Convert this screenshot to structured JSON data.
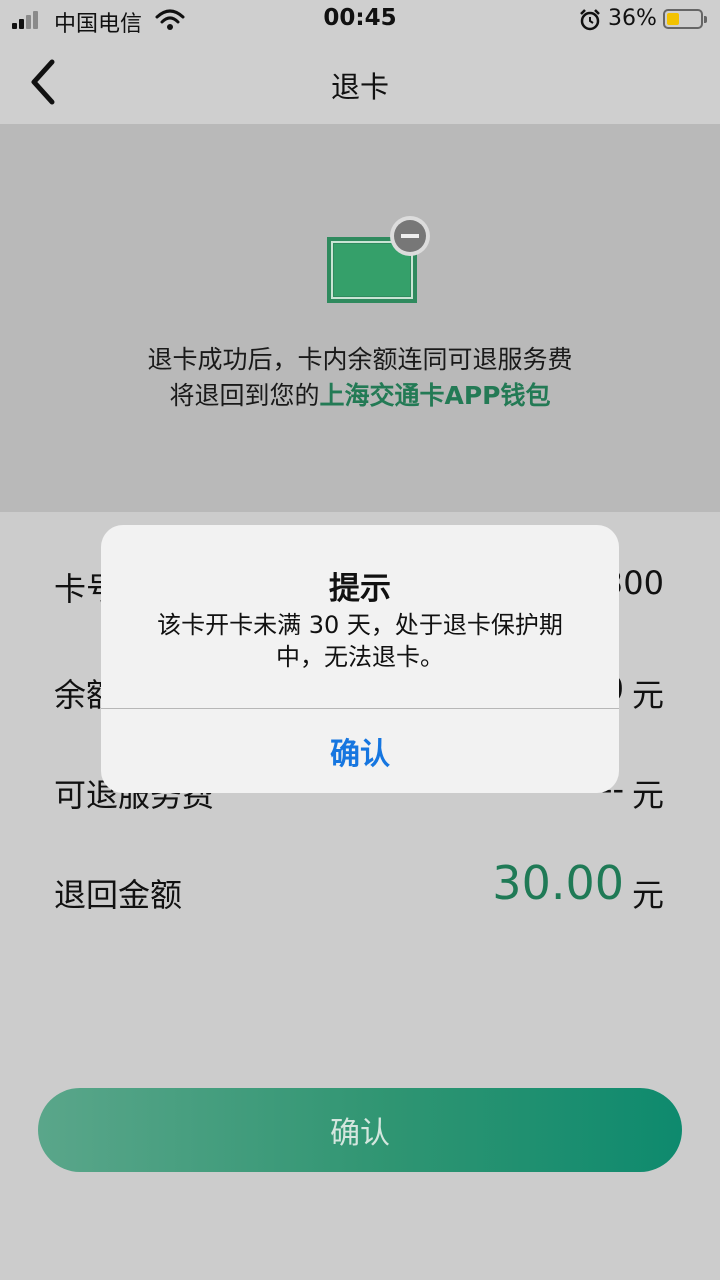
{
  "status_bar": {
    "carrier": "中国电信",
    "time": "00:45",
    "battery_percent": "36%",
    "battery_level": 0.36,
    "battery_color": "#f2c200",
    "icons": [
      "signal-icon",
      "wifi-icon",
      "alarm-icon",
      "battery-icon"
    ]
  },
  "nav": {
    "title": "退卡",
    "back_icon": "chevron-left-icon"
  },
  "hero": {
    "icon": "card-remove-icon",
    "line1": "退卡成功后，卡内余额连同可退服务费",
    "line2_prefix": "将退回到您的",
    "line2_highlight": "上海交通卡APP钱包",
    "highlight_color": "#237a55"
  },
  "rows": {
    "card_no": {
      "label": "卡号",
      "value": "300"
    },
    "balance": {
      "label": "余额",
      "value": "0",
      "unit": "元"
    },
    "service_fee": {
      "label": "可退服务费",
      "value": "--",
      "unit": "元"
    },
    "refund": {
      "label": "退回金额",
      "value": "30.00",
      "unit": "元"
    }
  },
  "confirm_button": {
    "label": "确认"
  },
  "dialog": {
    "title": "提示",
    "message": "该卡开卡未满 30 天，处于退卡保护期中，无法退卡。",
    "button": "确认",
    "button_color": "#1676e0"
  }
}
